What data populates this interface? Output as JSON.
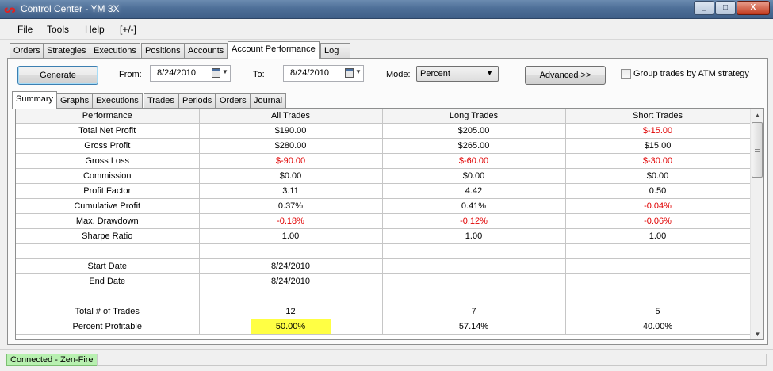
{
  "window": {
    "title": "Control Center - YM 3X",
    "controls": [
      "_",
      "□",
      "X"
    ]
  },
  "menu": [
    "File",
    "Tools",
    "Help",
    "[+/-]"
  ],
  "main_tabs": [
    "Orders",
    "Strategies",
    "Executions",
    "Positions",
    "Accounts",
    "Account Performance",
    "Log"
  ],
  "toolbar": {
    "generate_label": "Generate",
    "from_label": "From:",
    "from_value": "8/24/2010",
    "to_label": "To:",
    "to_value": "8/24/2010",
    "mode_label": "Mode:",
    "mode_value": "Percent",
    "advanced_label": "Advanced >>",
    "group_trades_label": "Group trades by ATM strategy",
    "group_trades_checked": false
  },
  "sub_tabs": [
    "Summary",
    "Graphs",
    "Executions",
    "Trades",
    "Periods",
    "Orders",
    "Journal"
  ],
  "table": {
    "columns": [
      "Performance",
      "All Trades",
      "Long Trades",
      "Short Trades"
    ],
    "rows": [
      {
        "label": "Total Net Profit",
        "all": "$190.00",
        "long": "$205.00",
        "short": "$-15.00"
      },
      {
        "label": "Gross Profit",
        "all": "$280.00",
        "long": "$265.00",
        "short": "$15.00"
      },
      {
        "label": "Gross Loss",
        "all": "$-90.00",
        "long": "$-60.00",
        "short": "$-30.00"
      },
      {
        "label": "Commission",
        "all": "$0.00",
        "long": "$0.00",
        "short": "$0.00"
      },
      {
        "label": "Profit Factor",
        "all": "3.11",
        "long": "4.42",
        "short": "0.50"
      },
      {
        "label": "Cumulative Profit",
        "all": "0.37%",
        "long": "0.41%",
        "short": "-0.04%"
      },
      {
        "label": "Max. Drawdown",
        "all": "-0.18%",
        "long": "-0.12%",
        "short": "-0.06%"
      },
      {
        "label": "Sharpe Ratio",
        "all": "1.00",
        "long": "1.00",
        "short": "1.00"
      },
      {
        "label": "",
        "all": "",
        "long": "",
        "short": ""
      },
      {
        "label": "Start Date",
        "all": "8/24/2010",
        "long": "",
        "short": ""
      },
      {
        "label": "End Date",
        "all": "8/24/2010",
        "long": "",
        "short": ""
      },
      {
        "label": "",
        "all": "",
        "long": "",
        "short": ""
      },
      {
        "label": "Total # of Trades",
        "all": "12",
        "long": "7",
        "short": "5"
      },
      {
        "label": "Percent Profitable",
        "all": "50.00%",
        "long": "57.14%",
        "short": "40.00%"
      }
    ]
  },
  "status": {
    "connection": "Connected - Zen-Fire"
  },
  "colors": {
    "negative": "#e00000",
    "highlight": "#ffff44",
    "connected": "#b8f0b0"
  }
}
